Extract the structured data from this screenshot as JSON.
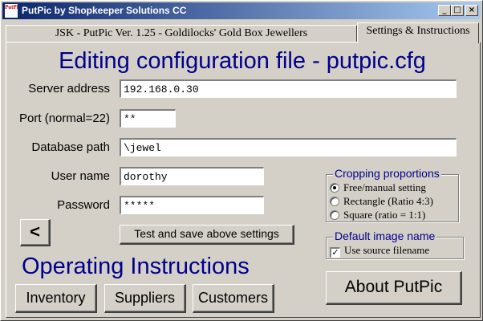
{
  "window": {
    "title": "PutPic by Shopkeeper Solutions CC",
    "app_icon": "PutPic"
  },
  "titlebar_buttons": {
    "minimize": "_",
    "maximize": "□",
    "close": "×"
  },
  "tabs": [
    {
      "label": "JSK - PutPic Ver. 1.25 - Goldilocks' Gold Box Jewellers"
    },
    {
      "label": "Settings & Instructions"
    }
  ],
  "config": {
    "heading": "Editing configuration file - putpic.cfg",
    "server_label": "Server address",
    "server_value": "192.168.0.30",
    "port_label": "Port (normal=22)",
    "port_value": "**",
    "db_label": "Database path",
    "db_value": "\\jewel",
    "user_label": "User name",
    "user_value": "dorothy",
    "password_label": "Password",
    "password_value": "*****"
  },
  "cropping": {
    "title": "Cropping proportions",
    "options": [
      {
        "label": "Free/manual setting",
        "selected": true
      },
      {
        "label": "Rectangle (Ratio 4:3)",
        "selected": false
      },
      {
        "label": "Square (ratio = 1:1)",
        "selected": false
      }
    ]
  },
  "default_image": {
    "title": "Default image name",
    "checkbox_label": "Use source filename",
    "checked": true,
    "check_mark": "✓"
  },
  "buttons": {
    "back": "<",
    "test_save": "Test and save above settings",
    "about": "About PutPic",
    "inventory": "Inventory",
    "suppliers": "Suppliers",
    "customers": "Customers"
  },
  "instructions": {
    "heading": "Operating Instructions"
  }
}
